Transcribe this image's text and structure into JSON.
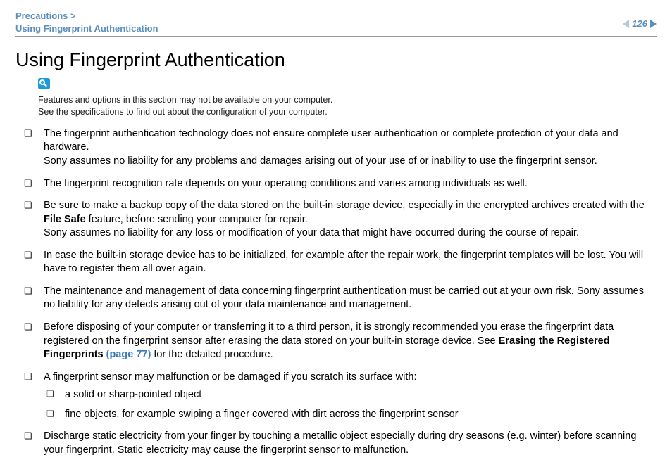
{
  "header": {
    "crumb1": "Precautions >",
    "crumb2": "Using Fingerprint Authentication",
    "page_number": "126"
  },
  "title": "Using Fingerprint Authentication",
  "note": {
    "line1": "Features and options in this section may not be available on your computer.",
    "line2": "See the specifications to find out about the configuration of your computer."
  },
  "items": [
    {
      "p1": "The fingerprint authentication technology does not ensure complete user authentication or complete protection of your data and hardware.",
      "p2": "Sony assumes no liability for any problems and damages arising out of your use of or inability to use the fingerprint sensor."
    },
    {
      "p1": "The fingerprint recognition rate depends on your operating conditions and varies among individuals as well."
    },
    {
      "p1a": "Be sure to make a backup copy of the data stored on the built-in storage device, especially in the encrypted archives created with the ",
      "bold1": "File Safe",
      "p1b": " feature, before sending your computer for repair.",
      "p2": "Sony assumes no liability for any loss or modification of your data that might have occurred during the course of repair."
    },
    {
      "p1": "In case the built-in storage device has to be initialized, for example after the repair work, the fingerprint templates will be lost. You will have to register them all over again."
    },
    {
      "p1": "The maintenance and management of data concerning fingerprint authentication must be carried out at your own risk. Sony assumes no liability for any defects arising out of your data maintenance and management."
    },
    {
      "p1a": "Before disposing of your computer or transferring it to a third person, it is strongly recommended you erase the fingerprint data registered on the fingerprint sensor after erasing the data stored on your built-in storage device. See ",
      "bold1": "Erasing the Registered Fingerprints ",
      "link1": "(page 77)",
      "p1b": " for the detailed procedure."
    },
    {
      "p1": "A fingerprint sensor may malfunction or be damaged if you scratch its surface with:",
      "sub": [
        "a solid or sharp-pointed object",
        "fine objects, for example swiping a finger covered with dirt across the fingerprint sensor"
      ]
    },
    {
      "p1": "Discharge static electricity from your finger by touching a metallic object especially during dry seasons (e.g. winter) before scanning your fingerprint. Static electricity may cause the fingerprint sensor to malfunction."
    }
  ]
}
